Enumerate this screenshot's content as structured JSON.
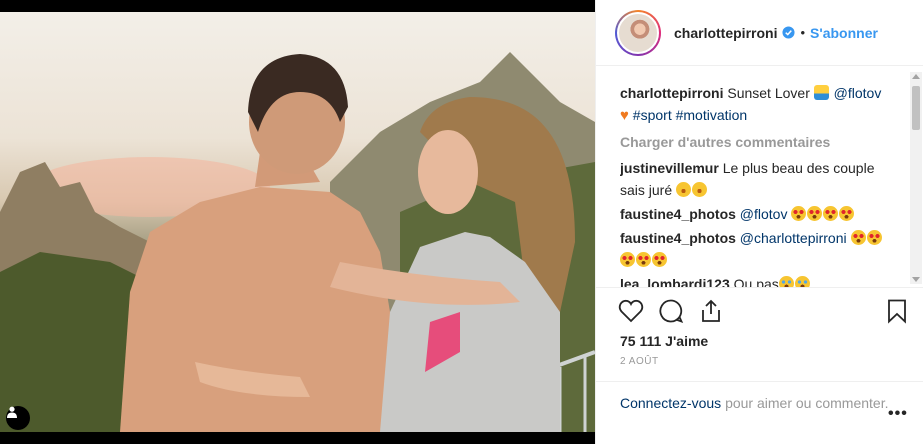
{
  "post": {
    "username": "charlottepirroni",
    "verified_icon": "verified-badge-icon",
    "dot": "•",
    "follow_label": "S'abonner"
  },
  "caption": {
    "user": "charlottepirroni",
    "text_before_emoji": "Sunset Lover",
    "mention": "@flotov",
    "hashtags": "#sport #motivation"
  },
  "load_more": "Charger d'autres commentaires",
  "comments": [
    {
      "user": "justinevillemur",
      "text": "Le plus beau des couple sais juré"
    },
    {
      "user": "faustine4_photos",
      "mention": "@flotov"
    },
    {
      "user": "faustine4_photos",
      "mention": "@charlottepirroni"
    },
    {
      "user": "lea_lombardi123",
      "text": "Ou pas"
    }
  ],
  "likes": "75 111 J'aime",
  "date": "2 AOÛT",
  "login": {
    "link": "Connectez-vous",
    "text": "pour aimer ou commenter."
  },
  "more_icon": "•••",
  "colors": {
    "link_blue": "#3897f0",
    "tag_blue": "#003569",
    "muted": "#999999",
    "text": "#262626"
  }
}
